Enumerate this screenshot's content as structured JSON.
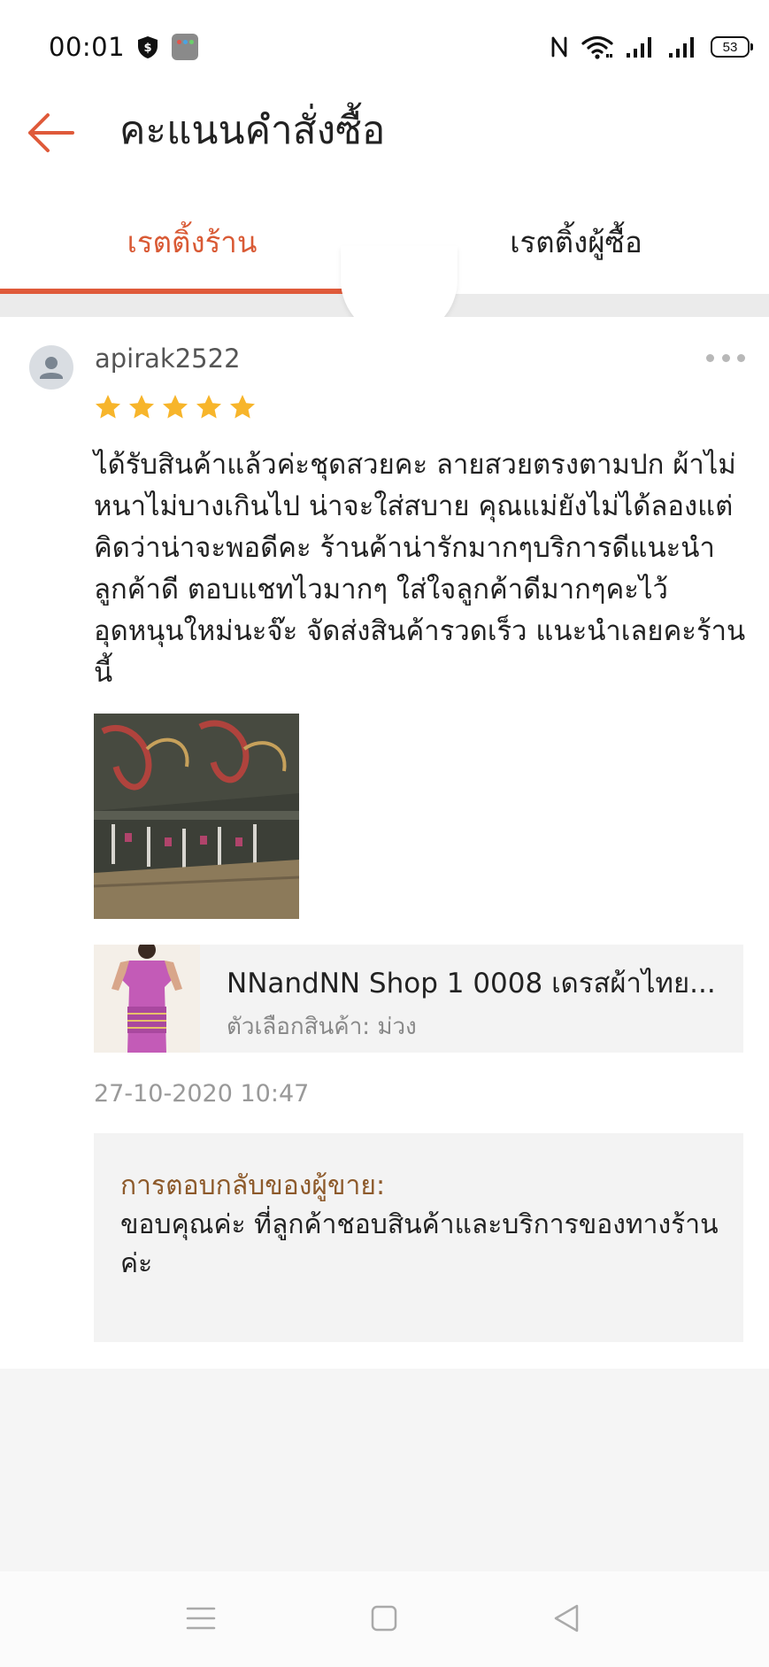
{
  "status_bar": {
    "time": "00:01",
    "battery": "53",
    "icons": [
      "shield-dollar-icon",
      "app-grid-icon",
      "nfc-icon",
      "wifi-icon",
      "signal-icon",
      "signal-icon",
      "battery-icon"
    ]
  },
  "header": {
    "title": "คะแนนคำสั่งซื้อ",
    "back_icon": "arrow-left-icon"
  },
  "tabs": [
    {
      "label": "เรตติ้งร้าน",
      "active": true
    },
    {
      "label": "เรตติ้งผู้ซื้อ",
      "active": false
    }
  ],
  "review": {
    "username": "apirak2522",
    "rating": 5,
    "text": "ได้รับสินค้าแล้วค่ะชุดสวยคะ ลายสวยตรงตามปก ผ้าไม่หนาไม่บางเกินไป น่าจะใส่สบาย คุณแม่ยังไม่ได้ลองแต่คิดว่าน่าจะพอดีคะ ร้านค้าน่ารักมากๆบริการดีแนะนำลูกค้าดี ตอบแชทไวมากๆ ใส่ใจลูกค้าดีมากๆคะไว้อุดหนุนใหม่นะจ๊ะ จัดส่งสินค้ารวดเร็ว แนะนำเลยคะร้านนี้",
    "product": {
      "name": "NNandNN Shop 1 0008 เดรสผ้าไทย...",
      "variant": "ตัวเลือกสินค้า: ม่วง"
    },
    "date": "27-10-2020 10:47",
    "seller_reply": {
      "label": "การตอบกลับของผู้ขาย:",
      "text": "ขอบคุณค่ะ ที่ลูกค้าชอบสินค้าและบริการของทางร้านค่ะ"
    }
  },
  "colors": {
    "accent": "#df5a3a",
    "star": "#f7b52b",
    "reply_label": "#8d5a2b"
  }
}
